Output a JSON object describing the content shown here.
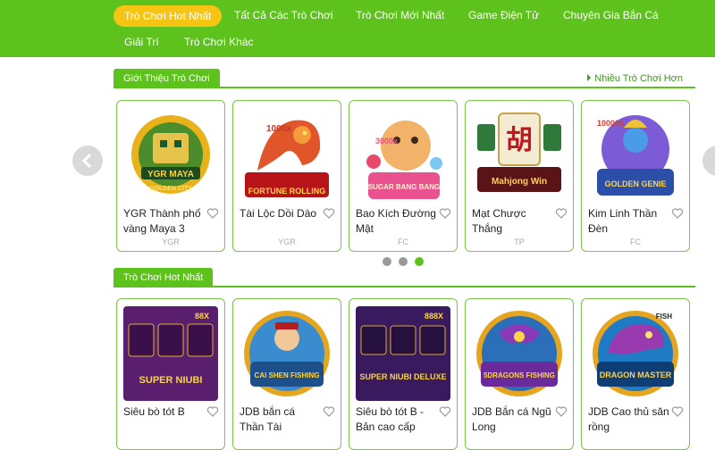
{
  "nav": {
    "items": [
      {
        "label": "Trò Chơi Hot Nhất",
        "active": true
      },
      {
        "label": "Tất Cả Các Trò Chơi",
        "active": false
      },
      {
        "label": "Trò Chơi Mới Nhất",
        "active": false
      },
      {
        "label": "Game Điện Tử",
        "active": false
      },
      {
        "label": "Chuyên Gia Bắn Cá",
        "active": false
      },
      {
        "label": "Giải Trí",
        "active": false
      },
      {
        "label": "Trò Chơi Khác",
        "active": false
      }
    ]
  },
  "intro": {
    "title": "Giới Thiệu Trò Chơi",
    "more": "Nhiều Trò Chơi Hơn",
    "games": [
      {
        "name": "YGR Thành phố vàng Maya 3",
        "provider": "YGR",
        "art_text": "YGR MAYA"
      },
      {
        "name": "Tài Lộc Dồi Dào",
        "provider": "YGR",
        "art_text": "FORTUNE ROLLING"
      },
      {
        "name": "Bao Kích Đường Mật",
        "provider": "FC",
        "art_text": "SUGAR BANG BANG"
      },
      {
        "name": "Mạt Chược Thắng",
        "provider": "TP",
        "art_text": "Mahjong Win"
      },
      {
        "name": "Kim Linh Thần Đèn",
        "provider": "FC",
        "art_text": "GOLDEN GENIE"
      }
    ]
  },
  "carousel": {
    "pages": 3,
    "active_page": 3
  },
  "hot": {
    "title": "Trò Chơi Hot Nhất",
    "games": [
      {
        "name": "Siêu bò tót B",
        "art_text": "SUPER NIUBI"
      },
      {
        "name": "JDB bắn cá Thần Tài",
        "art_text": "CAI SHEN FISHING"
      },
      {
        "name": "Siêu bò tót B - Bản cao cấp",
        "art_text": "SUPER NIUBI DELUXE"
      },
      {
        "name": "JDB Bắn cá Ngũ Long",
        "art_text": "5DRAGONS FISHING"
      },
      {
        "name": "JDB Cao thủ săn rồng",
        "art_text": "DRAGON MASTER"
      }
    ]
  },
  "colors": {
    "brand_green": "#5ec21c",
    "active_yellow": "#f6c514",
    "card_border": "#7cc44a"
  }
}
